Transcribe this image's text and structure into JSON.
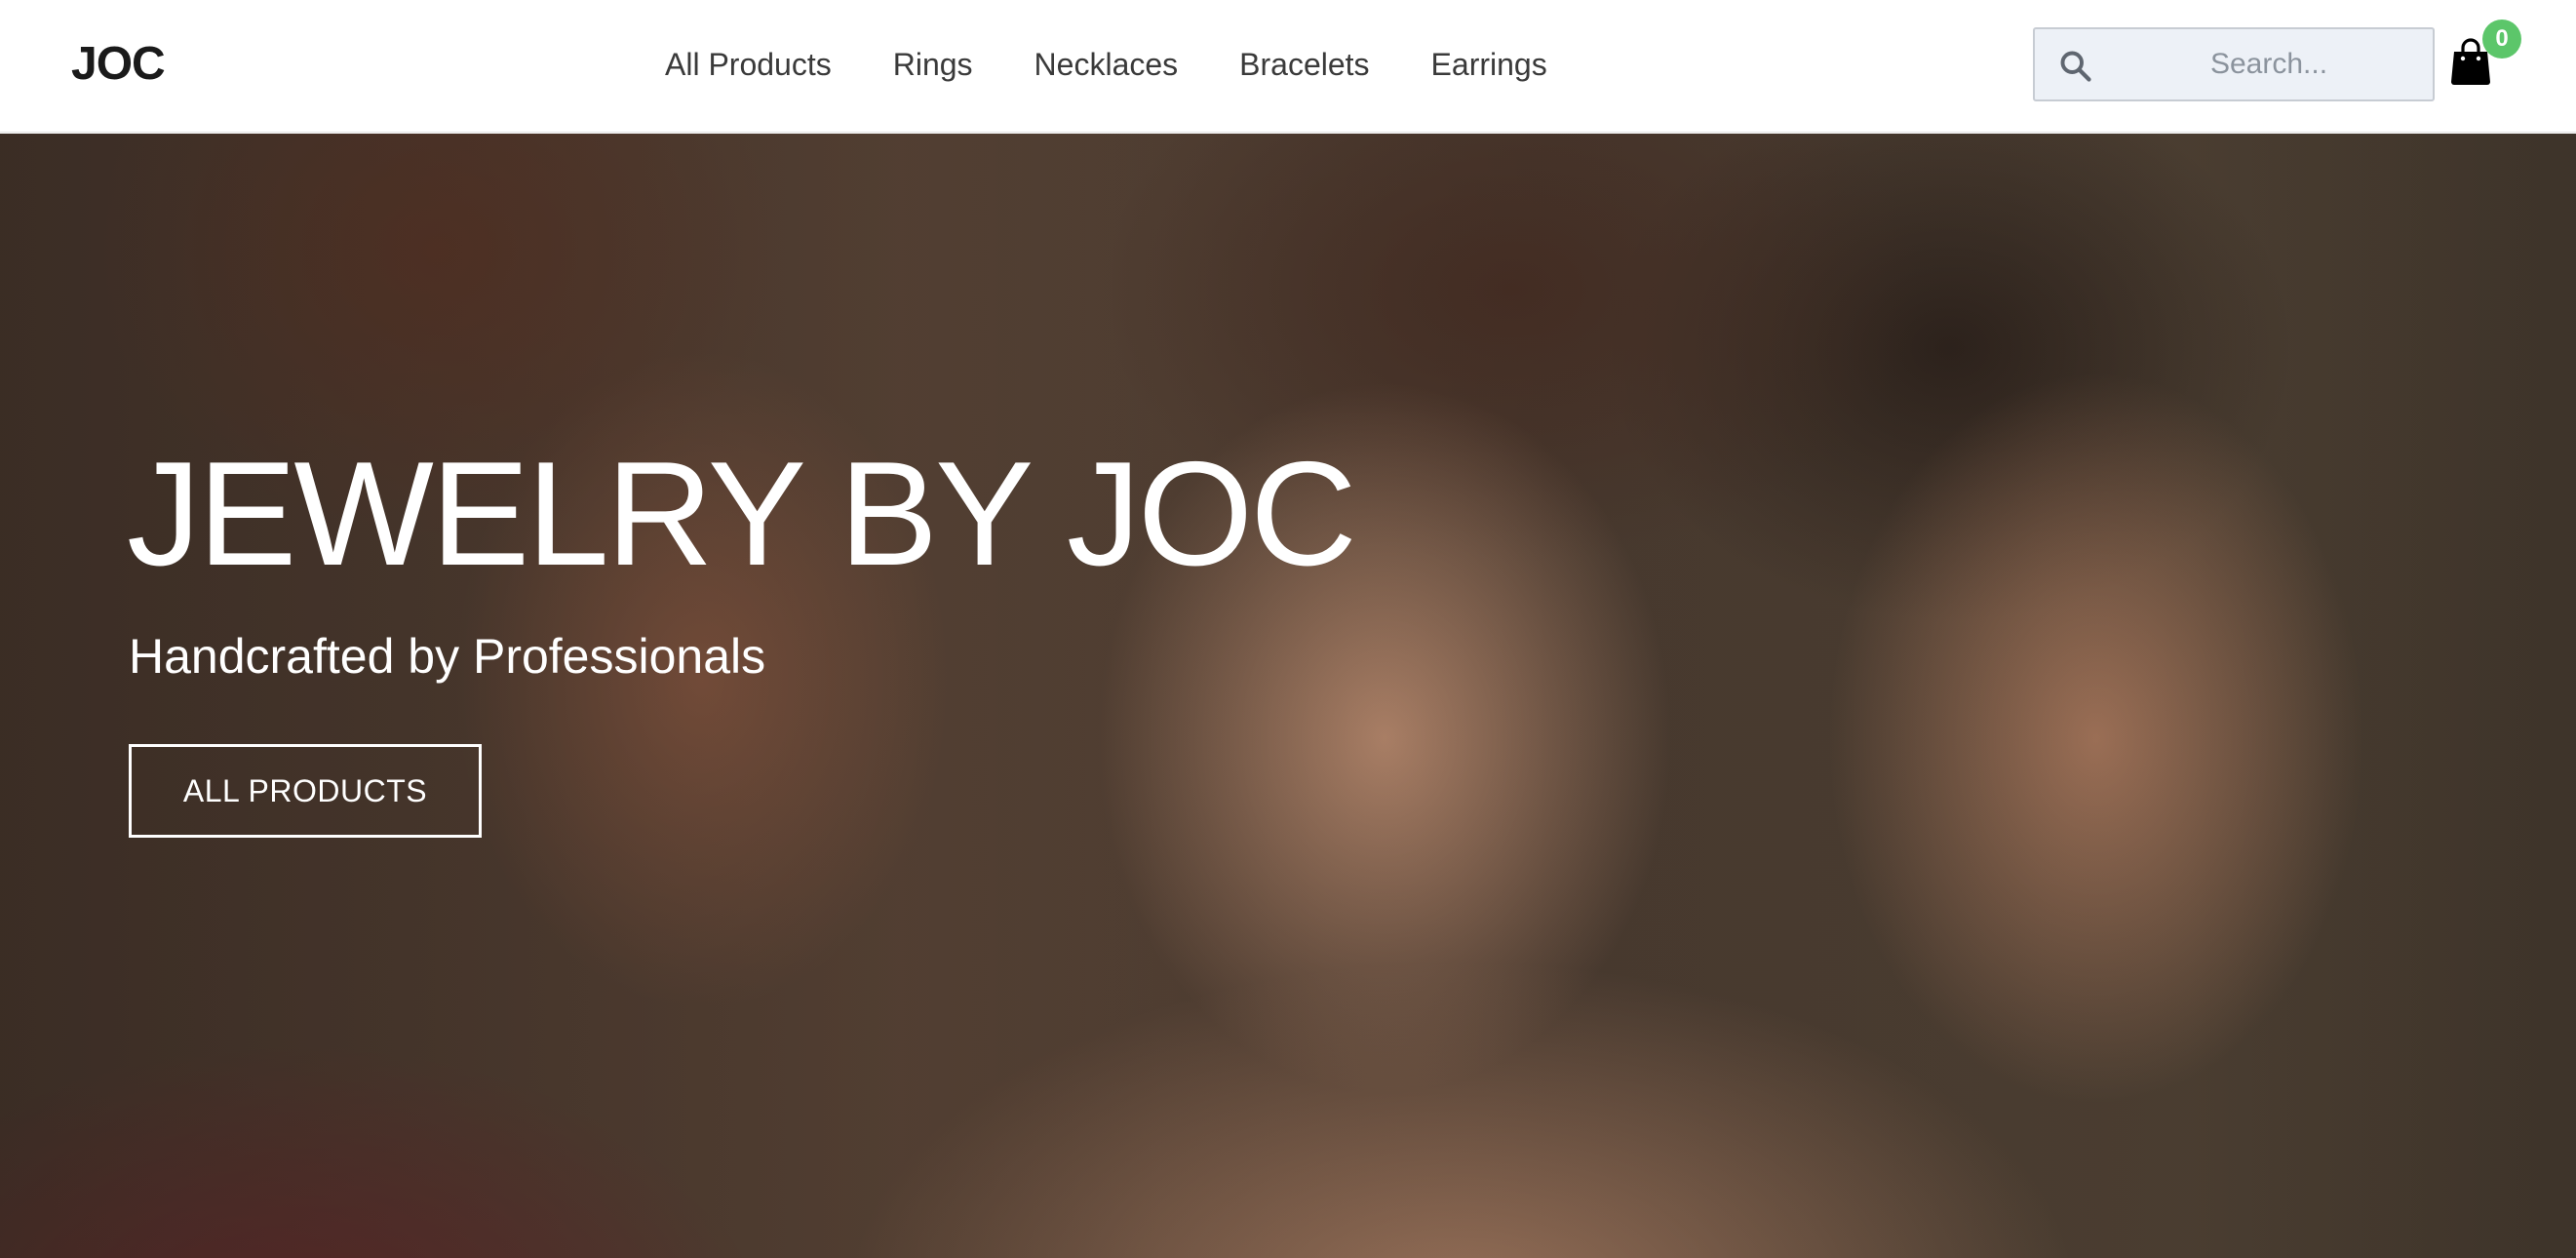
{
  "header": {
    "logo": "JOC",
    "nav": [
      {
        "label": "All Products"
      },
      {
        "label": "Rings"
      },
      {
        "label": "Necklaces"
      },
      {
        "label": "Bracelets"
      },
      {
        "label": "Earrings"
      }
    ],
    "search": {
      "placeholder": "Search...",
      "value": ""
    },
    "cart": {
      "count": "0",
      "icon": "shopping-bag-icon"
    }
  },
  "hero": {
    "title": "JEWELRY BY JOC",
    "subtitle": "Handcrafted by Professionals",
    "button_label": "ALL PRODUCTS",
    "image": "hero-models-photo"
  },
  "colors": {
    "header_bg": "#ffffff",
    "search_bg": "#edf1f7",
    "badge": "#5cc66a",
    "hero_text": "#ffffff"
  }
}
